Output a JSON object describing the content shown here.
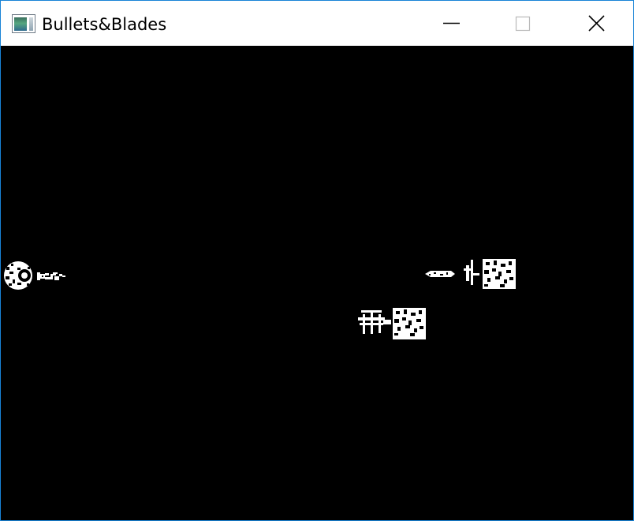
{
  "window": {
    "title": "Bullets&Blades",
    "app_icon": "app-window-icon",
    "controls": {
      "minimize_icon": "minimize-icon",
      "maximize_icon": "maximize-icon",
      "close_icon": "close-icon"
    },
    "border_color": "#1883d7"
  },
  "game": {
    "background_color": "#000000",
    "sprite_color": "#ffffff",
    "entities": [
      {
        "name": "player-ship"
      },
      {
        "name": "player-bullet"
      },
      {
        "name": "enemy-bullet"
      },
      {
        "name": "enemy-ship"
      },
      {
        "name": "enemy-ship"
      }
    ]
  }
}
